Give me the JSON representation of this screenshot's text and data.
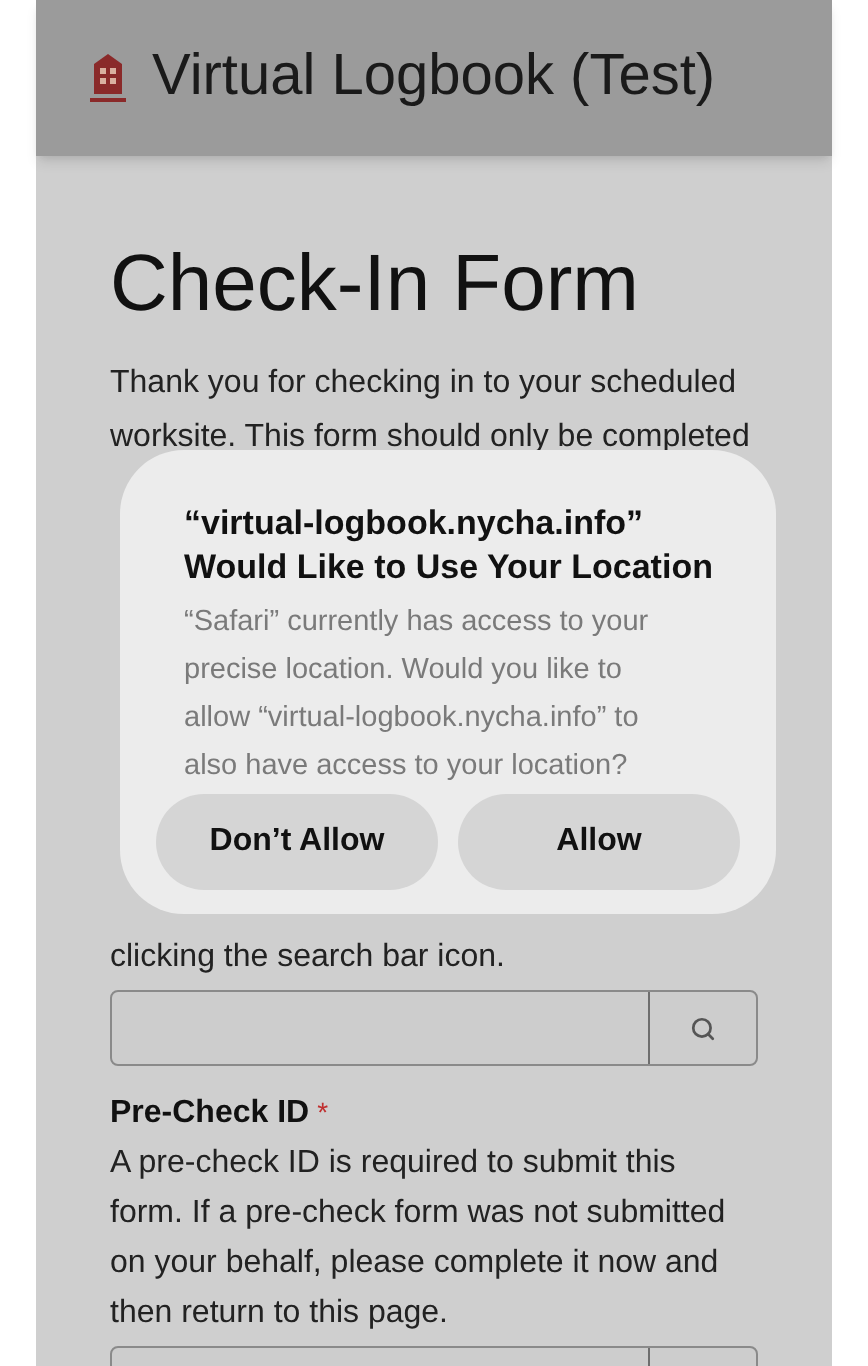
{
  "header": {
    "title": "Virtual Logbook (Test)"
  },
  "form": {
    "title": "Check-In Form",
    "intro_lines": [
      "Thank you for checking in to your scheduled",
      "worksite. This form should only be completed"
    ],
    "development": {
      "help_lines": [
        "clicking the search bar icon."
      ]
    },
    "pre_check": {
      "label": "Pre-Check ID",
      "required_mark": "*",
      "help_lines": [
        "A pre-check ID is required to submit this",
        "form. If a pre-check form was not submitted",
        "on your behalf, please complete it now and",
        "then return to this page."
      ]
    }
  },
  "dialog": {
    "title_lines": [
      "“virtual-logbook.nycha.info”",
      "Would Like to Use Your Location"
    ],
    "message_lines": [
      "“Safari” currently has access to your",
      "precise location. Would you like to",
      "allow “virtual-logbook.nycha.info” to",
      "also have access to your location?"
    ],
    "buttons": [
      "Don’t Allow",
      "Allow"
    ]
  }
}
